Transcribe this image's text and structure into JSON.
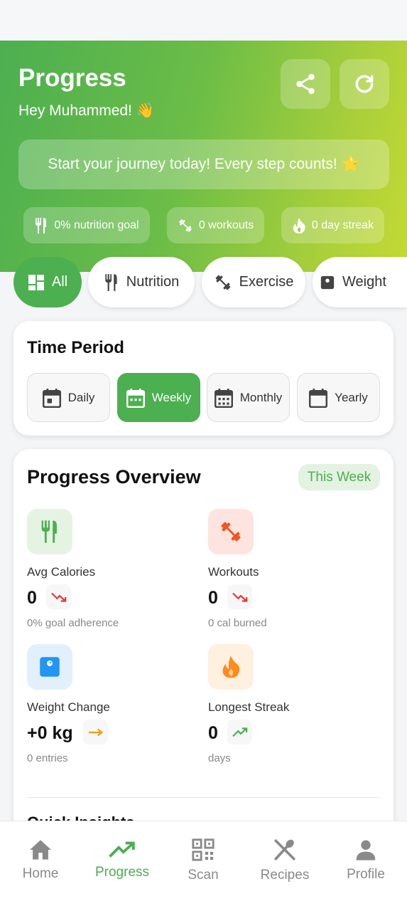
{
  "header": {
    "title": "Progress",
    "greeting": "Hey Muhammed! 👋",
    "banner": "Start your journey today! Every step counts! ⭐",
    "share_icon": "share-icon",
    "refresh_icon": "refresh-icon",
    "chips": [
      {
        "icon": "utensils-icon",
        "label": "0% nutrition goal"
      },
      {
        "icon": "dumbbell-icon",
        "label": "0 workouts"
      },
      {
        "icon": "flame-icon",
        "label": "0 day streak"
      }
    ]
  },
  "filter_tabs": [
    {
      "label": "All",
      "icon": "grid-icon",
      "active": true
    },
    {
      "label": "Nutrition",
      "icon": "utensils-icon",
      "active": false
    },
    {
      "label": "Exercise",
      "icon": "dumbbell-icon",
      "active": false
    },
    {
      "label": "Weight",
      "icon": "scale-icon",
      "active": false
    }
  ],
  "time_period": {
    "title": "Time Period",
    "options": [
      {
        "label": "Daily",
        "active": false
      },
      {
        "label": "Weekly",
        "active": true
      },
      {
        "label": "Monthly",
        "active": false
      },
      {
        "label": "Yearly",
        "active": false
      }
    ]
  },
  "overview": {
    "title": "Progress Overview",
    "badge": "This Week",
    "stats": [
      {
        "label": "Avg Calories",
        "value": "0",
        "sub": "0% goal adherence",
        "icon": "utensils-icon",
        "trend": "trend-down-icon"
      },
      {
        "label": "Workouts",
        "value": "0",
        "sub": "0 cal burned",
        "icon": "dumbbell-icon",
        "trend": "trend-down-icon"
      },
      {
        "label": "Weight Change",
        "value": "+0 kg",
        "sub": "0 entries",
        "icon": "scale-icon",
        "trend": "arrow-right-icon"
      },
      {
        "label": "Longest Streak",
        "value": "0",
        "sub": "days",
        "icon": "flame-icon",
        "trend": "trend-up-icon"
      }
    ],
    "next_section_title": "Quick Insights"
  },
  "nav": [
    {
      "label": "Home",
      "icon": "home-icon",
      "active": false
    },
    {
      "label": "Progress",
      "icon": "trend-up-icon",
      "active": true
    },
    {
      "label": "Scan",
      "icon": "qr-scan-icon",
      "active": false
    },
    {
      "label": "Recipes",
      "icon": "recipes-icon",
      "active": false
    },
    {
      "label": "Profile",
      "icon": "profile-icon",
      "active": false
    }
  ],
  "colors": {
    "primary_green": "#4caf50",
    "gradient_end": "#c4da34",
    "trend_down": "#e53935",
    "trend_flat": "#f39c12",
    "trend_up": "#4caf50",
    "weight_blue": "#2196f3",
    "flame_orange": "#ff8a1f",
    "dumbbell_red": "#f4511e"
  }
}
